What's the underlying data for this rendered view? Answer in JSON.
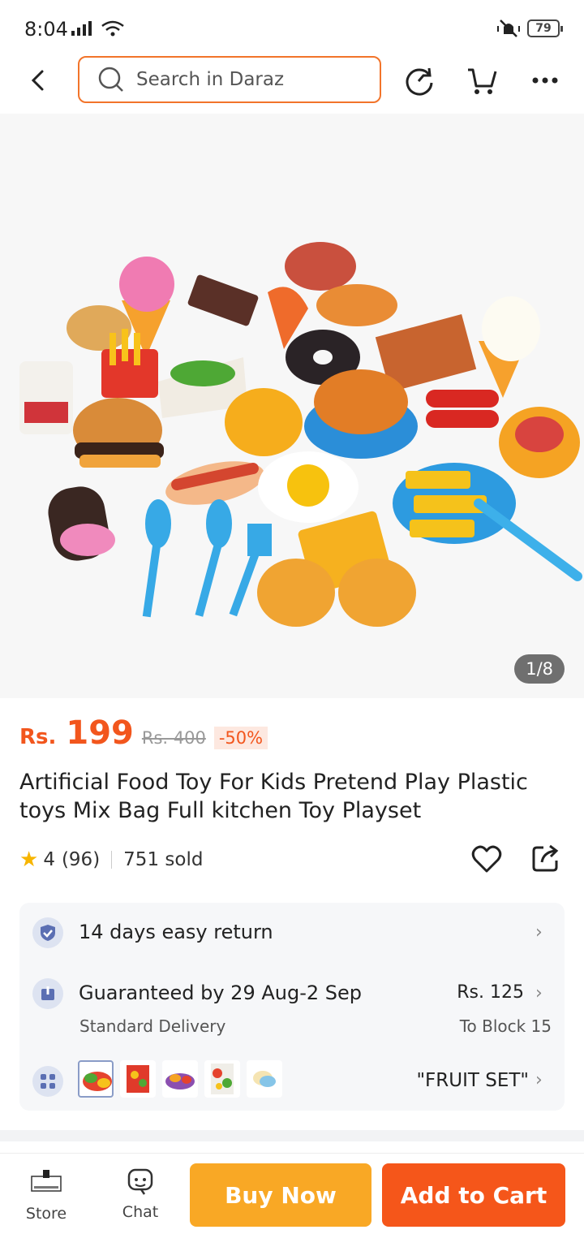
{
  "status_bar": {
    "time": "8:04",
    "battery": "79"
  },
  "header": {
    "search_placeholder": "Search in Daraz",
    "icons": [
      "back-icon",
      "search-icon",
      "history-icon",
      "cart-icon",
      "more-icon"
    ]
  },
  "gallery": {
    "counter": "1/8"
  },
  "product": {
    "currency": "Rs.",
    "price": "199",
    "original_price": "Rs. 400",
    "discount": "-50%",
    "title": "Artificial Food Toy For Kids Pretend Play Plastic toys Mix Bag Full kitchen Toy Playset",
    "rating": "4",
    "rating_count": "(96)",
    "sold": "751 sold"
  },
  "info_card": {
    "return_policy": "14 days easy return",
    "delivery_guarantee": "Guaranteed by 29 Aug-2 Sep",
    "delivery_type": "Standard Delivery",
    "delivery_fee": "Rs. 125",
    "delivery_location": "To Block 15",
    "variant": "\"FRUIT SET\""
  },
  "bottom_bar": {
    "store_label": "Store",
    "chat_label": "Chat",
    "buy_now": "Buy Now",
    "add_to_cart": "Add to Cart"
  },
  "colors": {
    "accent": "#f5561a",
    "buy": "#f9a825",
    "search_border": "#f2742a"
  }
}
